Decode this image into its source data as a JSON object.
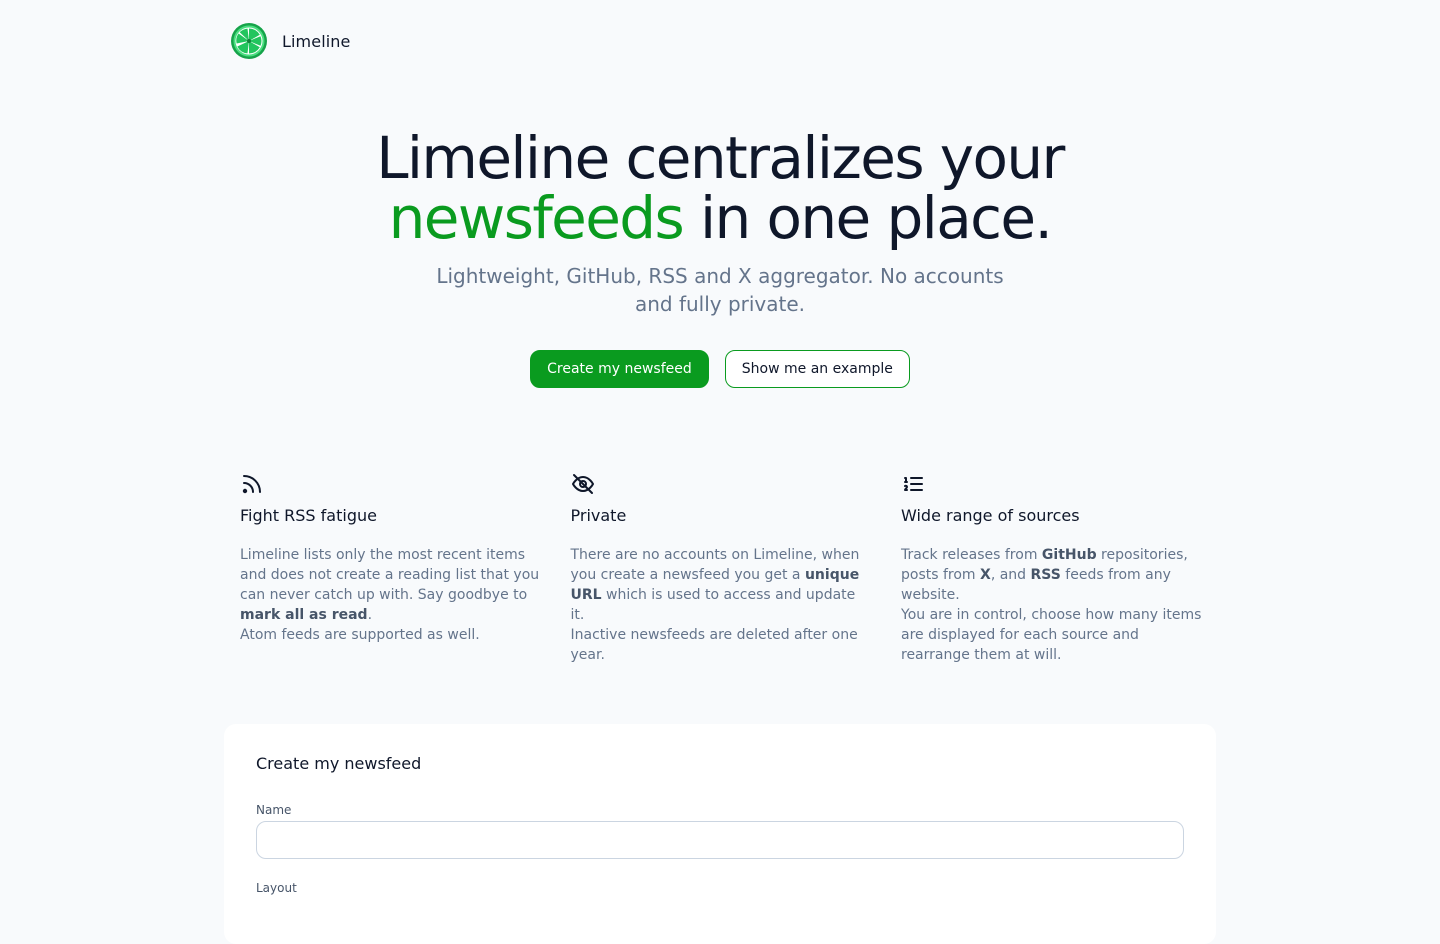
{
  "header": {
    "brand": "Limeline"
  },
  "hero": {
    "title_line1": "Limeline centralizes your",
    "title_accent": "newsfeeds",
    "title_rest": " in one place.",
    "subtitle": "Lightweight, GitHub, RSS and X aggregator. No accounts and fully private.",
    "primary_cta": "Create my newsfeed",
    "secondary_cta": "Show me an example"
  },
  "features": [
    {
      "icon": "rss-icon",
      "title": "Fight RSS fatigue",
      "desc": [
        {
          "t": "Limeline lists only the most recent items and does not create a reading list that you can never catch up with. Say goodbye to "
        },
        {
          "t": "mark all as read",
          "b": true
        },
        {
          "t": "."
        },
        {
          "br": true
        },
        {
          "t": "Atom feeds are supported as well."
        }
      ]
    },
    {
      "icon": "eye-off-icon",
      "title": "Private",
      "desc": [
        {
          "t": "There are no accounts on Limeline, when you create a newsfeed you get a "
        },
        {
          "t": "unique URL",
          "b": true
        },
        {
          "t": " which is used to access and update it."
        },
        {
          "br": true
        },
        {
          "t": "Inactive newsfeeds are deleted after one year."
        }
      ]
    },
    {
      "icon": "list-ordered-icon",
      "title": "Wide range of sources",
      "desc": [
        {
          "t": "Track releases from "
        },
        {
          "t": "GitHub",
          "b": true
        },
        {
          "t": " repositories, posts from "
        },
        {
          "t": "X",
          "b": true
        },
        {
          "t": ", and "
        },
        {
          "t": "RSS",
          "b": true
        },
        {
          "t": " feeds from any website."
        },
        {
          "br": true
        },
        {
          "t": "You are in control, choose how many items are displayed for each source and rearrange them at will."
        }
      ]
    }
  ],
  "form": {
    "title": "Create my newsfeed",
    "name_label": "Name",
    "name_value": "",
    "layout_label": "Layout"
  },
  "colors": {
    "accent": "#0a9b1f",
    "text": "#0f172a",
    "muted": "#64748b",
    "background": "#f8fafc"
  }
}
